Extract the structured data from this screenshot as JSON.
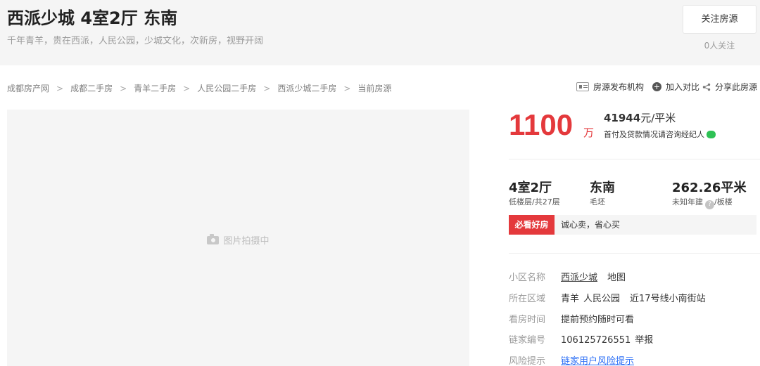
{
  "header": {
    "title": "西派少城 4室2厅 东南",
    "subtitle": "千年青羊，贵在西派，人民公园，少城文化，次新房，视野开阔",
    "follow_button": "关注房源",
    "follow_count": "0人关注"
  },
  "breadcrumb": {
    "items": [
      "成都房产网",
      "成都二手房",
      "青羊二手房",
      "人民公园二手房",
      "西派少城二手房",
      "当前房源"
    ],
    "separator": ">"
  },
  "tools": {
    "agency": "房源发布机构",
    "compare": "加入对比",
    "share": "分享此房源"
  },
  "photo": {
    "placeholder": "图片拍摄中"
  },
  "price": {
    "total": "1100",
    "total_unit": "万",
    "unit_value": "41944",
    "unit_suffix": "元/平米",
    "note": "首付及贷款情况请咨询经纪人"
  },
  "specs": {
    "room_main": "4室2厅",
    "room_sub": "低楼层/共27层",
    "orient_main": "东南",
    "orient_sub": "毛坯",
    "area_main": "262.26平米",
    "area_sub_left": "未知年建",
    "area_sub_right": "/板楼",
    "help_glyph": "?"
  },
  "promo": {
    "tag": "必看好房",
    "text": "诚心卖，省心买"
  },
  "info": {
    "community_label": "小区名称",
    "community_value": "西派少城",
    "community_map": "地图",
    "area_label": "所在区域",
    "area_district": "青羊",
    "area_sub": "人民公园",
    "area_near": "近17号线小南街站",
    "visit_label": "看房时间",
    "visit_value": "提前预约随时可看",
    "code_label": "链家编号",
    "code_value": "106125726551",
    "code_report": "举报",
    "risk_label": "风险提示",
    "risk_value": "链家用户风险提示"
  },
  "colors": {
    "accent_red": "#e4393c",
    "link_blue": "#3072f6",
    "chat_green": "#2ec155"
  }
}
